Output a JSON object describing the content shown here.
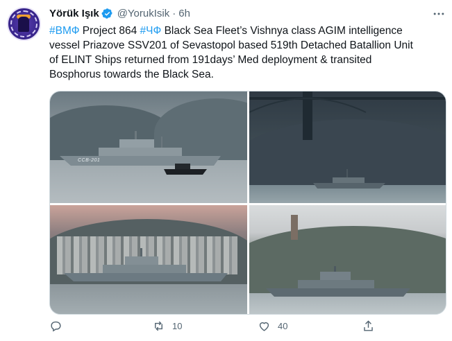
{
  "tweet": {
    "display_name": "Yörük Işık",
    "handle": "@YorukIsik",
    "separator": "·",
    "time": "6h",
    "text": {
      "tag1": "#ВМФ",
      "seg1": " Project 864 ",
      "tag2": "#ЧФ",
      "seg2": " Black Sea Fleet’s Vishnya class AGIM intelligence",
      "line2": "vessel Priazove SSV201 of Sevastopol based 519th Detached Batallion Unit",
      "line3": "of ELINT Ships returned from 191days’ Med deployment & transited",
      "line4": "Bosphorus towards the Black Sea."
    },
    "ship_hull_label": "ССВ-201",
    "actions": {
      "reply_count": "",
      "retweet_count": "10",
      "like_count": "40"
    }
  },
  "colors": {
    "accent": "#1d9bf0",
    "text": "#0f1419",
    "muted": "#536471",
    "border": "#cfd9de"
  },
  "icons": {
    "verified": "verified-badge-icon",
    "more": "more-dots-icon",
    "reply": "reply-icon",
    "retweet": "retweet-icon",
    "like": "heart-icon",
    "share": "share-icon"
  }
}
